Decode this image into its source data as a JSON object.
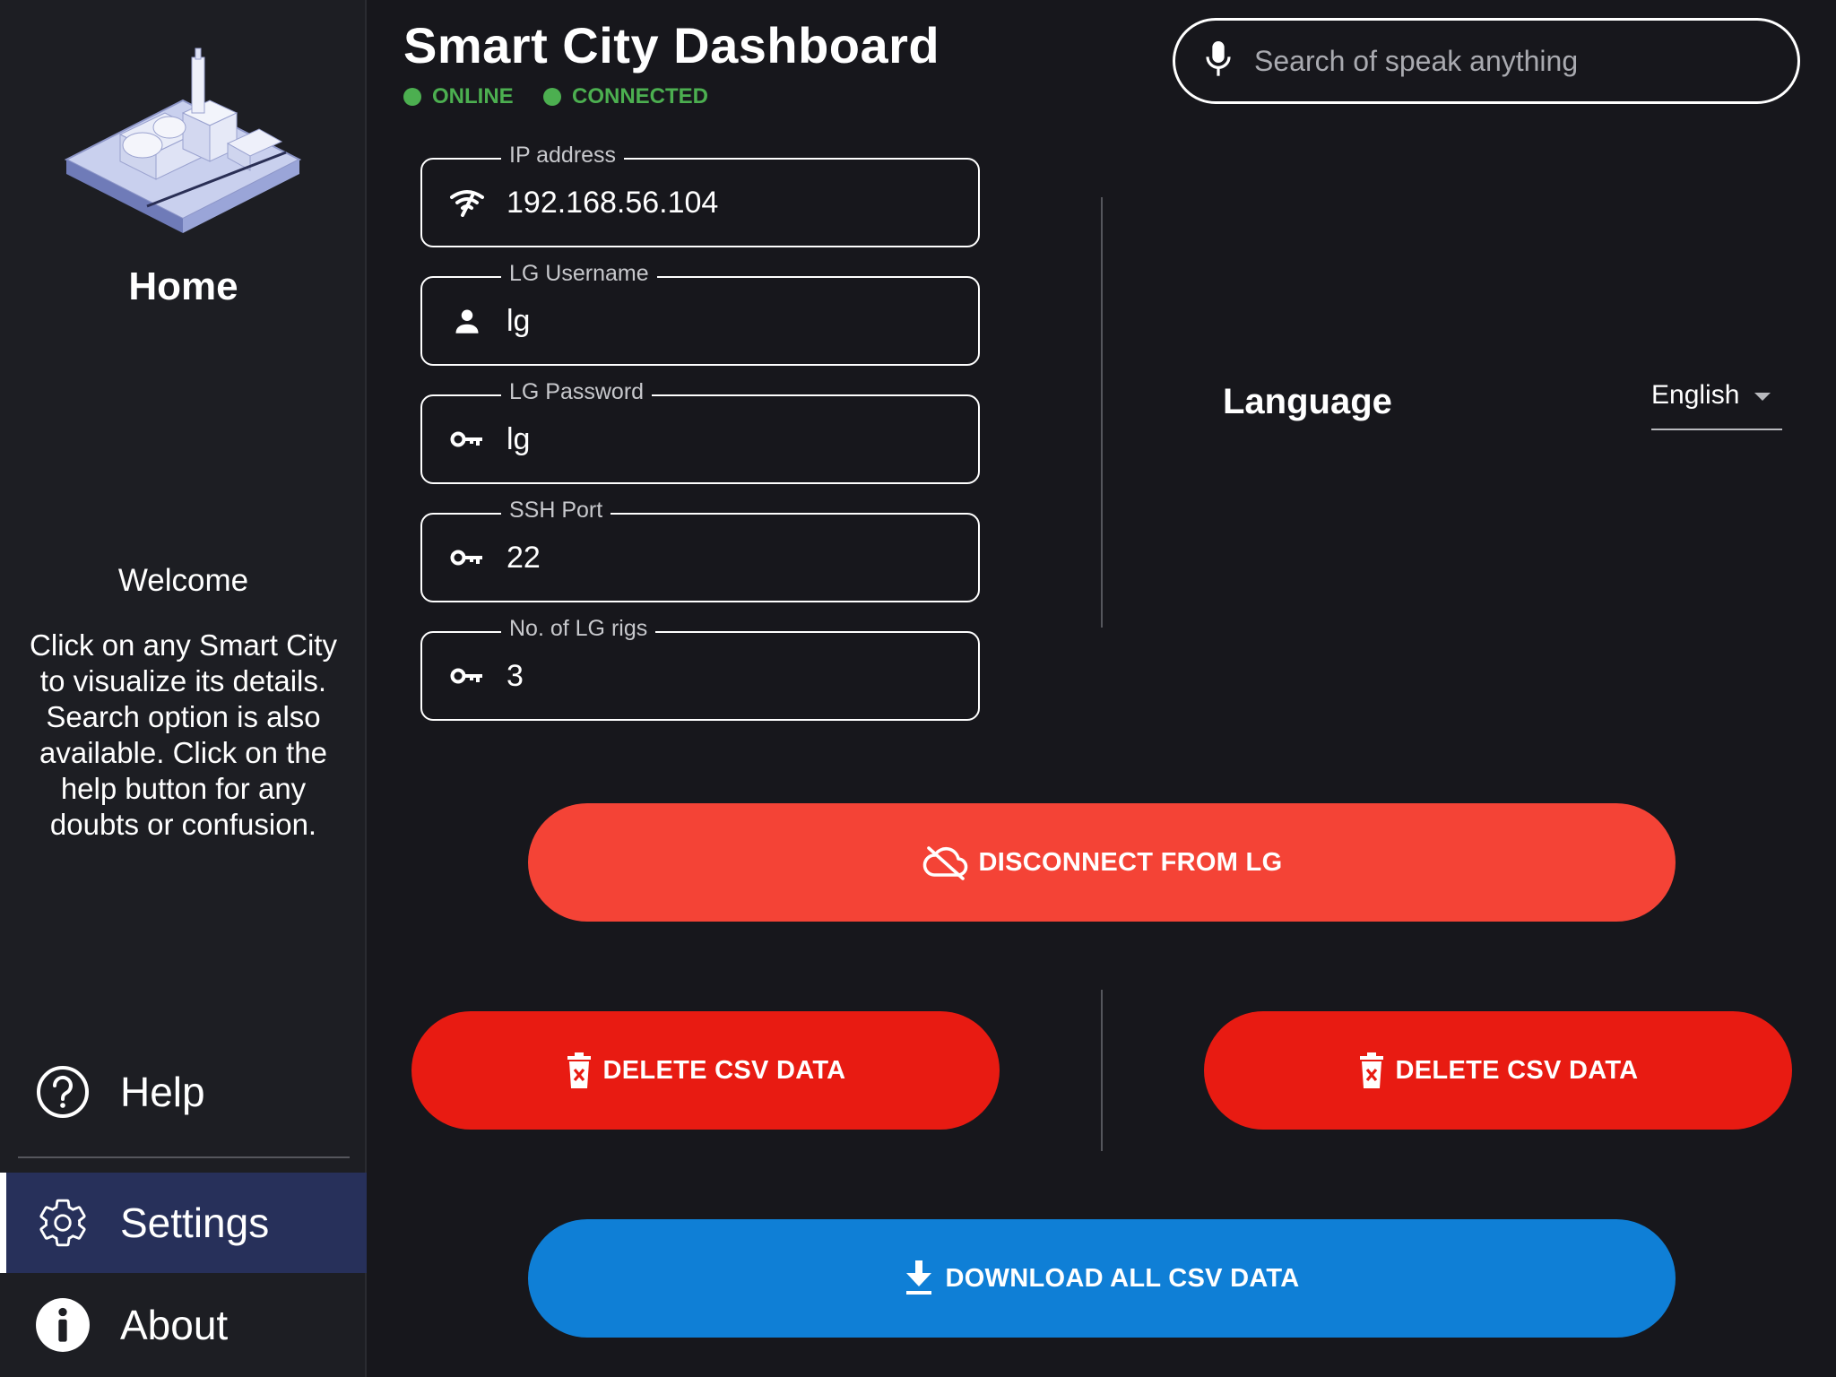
{
  "sidebar": {
    "home_label": "Home",
    "welcome_title": "Welcome",
    "welcome_text": "Click on any Smart City to visualize its details. Search option is also available. Click on the help button for any doubts or confusion.",
    "nav": {
      "help": "Help",
      "settings": "Settings",
      "about": "About"
    },
    "active_item": "settings"
  },
  "header": {
    "title": "Smart City Dashboard",
    "status_online": "ONLINE",
    "status_connected": "CONNECTED"
  },
  "search": {
    "placeholder": "Search of speak anything",
    "value": ""
  },
  "fields": {
    "ip": {
      "label": "IP address",
      "value": "192.168.56.104"
    },
    "username": {
      "label": "LG Username",
      "value": "lg"
    },
    "password": {
      "label": "LG Password",
      "value": "lg"
    },
    "ssh_port": {
      "label": "SSH Port",
      "value": "22"
    },
    "rigs": {
      "label": "No. of LG rigs",
      "value": "3"
    }
  },
  "language": {
    "label": "Language",
    "selected": "English"
  },
  "buttons": {
    "disconnect": "DISCONNECT FROM LG",
    "delete_csv_1": "DELETE CSV DATA",
    "delete_csv_2": "DELETE CSV DATA",
    "download_csv": "DOWNLOAD ALL CSV DATA"
  },
  "colors": {
    "background": "#17171c",
    "sidebar": "#1d1e23",
    "active_nav": "#27305a",
    "status_green": "#4caf50",
    "disconnect_red": "#f44336",
    "delete_red": "#e81b12",
    "download_blue": "#0f7fd6"
  },
  "icons": {
    "logo": "isometric-city-logo",
    "help": "help-circle-icon",
    "settings": "gear-icon",
    "about": "info-circle-icon",
    "mic": "mic-icon",
    "ip": "wifi-signal-icon",
    "username": "person-icon",
    "password": "key-icon",
    "ssh_port": "key-icon",
    "rigs": "key-icon",
    "disconnect": "cloud-off-icon",
    "delete": "trash-icon",
    "download": "download-icon"
  }
}
